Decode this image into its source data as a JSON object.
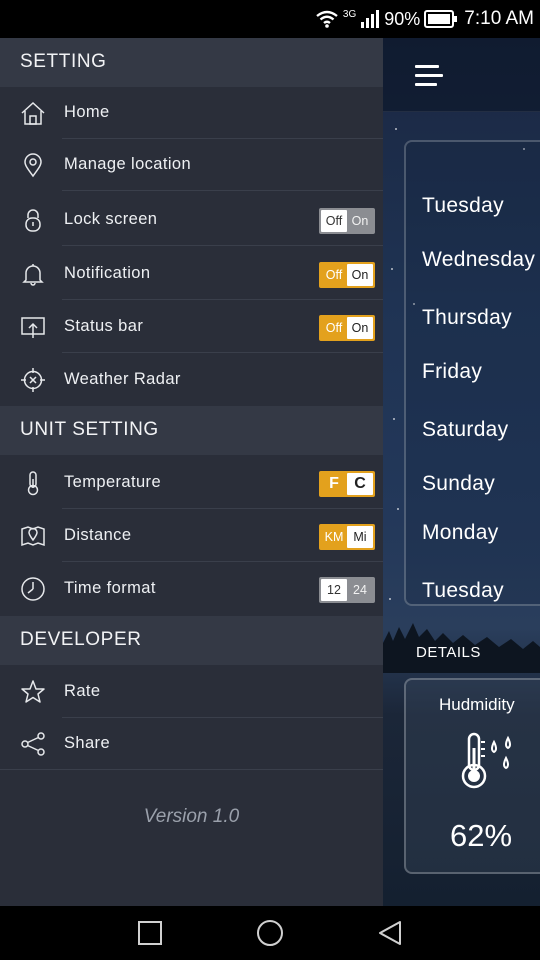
{
  "status_bar": {
    "network": "3G",
    "battery": "90%",
    "time": "7:10 AM",
    "icons": [
      "wifi-icon",
      "signal-icon",
      "battery-icon"
    ]
  },
  "drawer": {
    "sections": [
      {
        "title": "SETTING",
        "items": [
          {
            "label": "Home",
            "icon": "home-icon"
          },
          {
            "label": "Manage location",
            "icon": "location-pin-icon"
          },
          {
            "label": "Lock screen",
            "icon": "lock-icon",
            "toggle": {
              "left": "Off",
              "right": "On",
              "selected": "Off"
            }
          },
          {
            "label": "Notification",
            "icon": "bell-icon",
            "toggle": {
              "left": "Off",
              "right": "On",
              "selected": "On"
            }
          },
          {
            "label": "Status bar",
            "icon": "status-bar-icon",
            "toggle": {
              "left": "Off",
              "right": "On",
              "selected": "On"
            }
          },
          {
            "label": "Weather Radar",
            "icon": "crosshair-icon"
          }
        ]
      },
      {
        "title": "UNIT SETTING",
        "items": [
          {
            "label": "Temperature",
            "icon": "thermometer-icon",
            "toggle": {
              "left": "F",
              "right": "C",
              "selected": "C"
            }
          },
          {
            "label": "Distance",
            "icon": "map-pin-icon",
            "toggle": {
              "left": "KM",
              "right": "Mi",
              "selected": "Mi"
            }
          },
          {
            "label": "Time format",
            "icon": "clock-icon",
            "toggle": {
              "left": "12",
              "right": "24",
              "selected": "12"
            }
          }
        ]
      },
      {
        "title": "DEVELOPER",
        "items": [
          {
            "label": "Rate",
            "icon": "star-icon"
          },
          {
            "label": "Share",
            "icon": "share-icon"
          }
        ]
      }
    ],
    "version": "Version 1.0"
  },
  "background": {
    "days": [
      "Tuesday",
      "Wednesday",
      "Thursday",
      "Friday",
      "Saturday",
      "Sunday",
      "Monday",
      "Tuesday"
    ],
    "details_label": "DETAILS",
    "humidity": {
      "title": "Hudmidity",
      "value": "62%"
    }
  },
  "colors": {
    "accent": "#e3a11d",
    "drawer_bg": "#2a2e39",
    "section_bg": "#343945"
  },
  "nav": [
    "recent-apps-button",
    "home-button",
    "back-button"
  ]
}
